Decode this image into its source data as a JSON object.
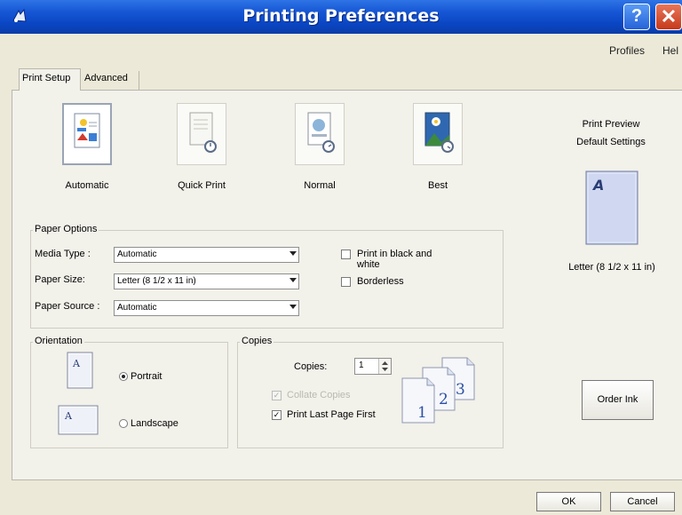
{
  "window": {
    "title": "Printing Preferences",
    "help_label": "?",
    "close_label": "✕"
  },
  "menu": {
    "profiles": "Profiles",
    "help": "Hel"
  },
  "tabs": [
    {
      "label": "Print Setup",
      "active": true
    },
    {
      "label": "Advanced",
      "active": false
    }
  ],
  "quality": {
    "selected": "Automatic",
    "options": [
      {
        "label": "Automatic"
      },
      {
        "label": "Quick Print"
      },
      {
        "label": "Normal"
      },
      {
        "label": "Best"
      }
    ]
  },
  "paper_options": {
    "group_label": "Paper Options",
    "media_type": {
      "label": "Media Type :",
      "value": "Automatic"
    },
    "paper_size": {
      "label": "Paper Size:",
      "value": "Letter (8 1/2 x 11 in)"
    },
    "paper_source": {
      "label": "Paper Source :",
      "value": "Automatic"
    },
    "black_and_white": {
      "label_line1": "Print in black and",
      "label_line2": "white",
      "checked": false
    },
    "borderless": {
      "label": "Borderless",
      "checked": false
    }
  },
  "orientation": {
    "group_label": "Orientation",
    "selected": "Portrait",
    "portrait_label": "Portrait",
    "landscape_label": "Landscape",
    "thumb_letter": "A"
  },
  "copies": {
    "group_label": "Copies",
    "label": "Copies:",
    "value": "1",
    "collate": {
      "label": "Collate Copies",
      "checked": true,
      "enabled": false
    },
    "last_page_first": {
      "label": "Print Last Page First",
      "checked": true
    },
    "page_numbers": [
      "1",
      "2",
      "3"
    ]
  },
  "preview": {
    "title": "Print Preview",
    "subtitle": "Default Settings",
    "page_letter": "A",
    "size_caption": "Letter (8 1/2 x 11 in)"
  },
  "buttons": {
    "order_ink": "Order Ink",
    "ok": "OK",
    "cancel": "Cancel"
  },
  "colors": {
    "titlebar": "#0a46c4",
    "dialog_background": "#ece9d8",
    "panel_background": "#f2f1ea",
    "preview_page": "#c9d3ee"
  }
}
